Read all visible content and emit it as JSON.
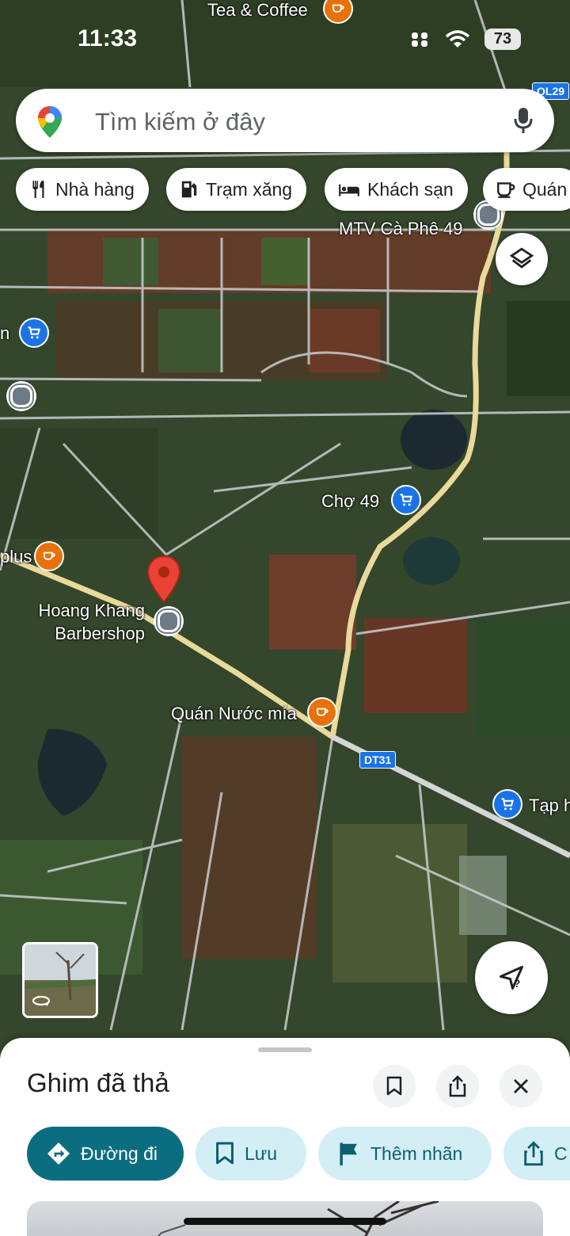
{
  "status_bar": {
    "time": "11:33",
    "battery": "73"
  },
  "search": {
    "placeholder": "Tìm kiếm ở đây"
  },
  "chips": [
    {
      "label": "Nhà hàng",
      "icon": "fork-knife-icon"
    },
    {
      "label": "Trạm xăng",
      "icon": "gas-pump-icon"
    },
    {
      "label": "Khách sạn",
      "icon": "bed-icon"
    },
    {
      "label": "Quán",
      "icon": "coffee-cup-icon"
    }
  ],
  "map": {
    "labels": {
      "tea_coffee": "Tea & Coffee",
      "cafe_49": "MTV Cà Phê 49",
      "market_49": "Chợ 49",
      "plus": "plus",
      "barbershop_line1": "Hoang Khang",
      "barbershop_line2": "Barbershop",
      "nuoc_mia": "Quán Nước mía",
      "tap_hoa": "Tạp h",
      "left_n": "n",
      "road_dt31": "DT31",
      "road_ql29": "QL29"
    }
  },
  "sheet": {
    "title": "Ghim đã thả",
    "actions": [
      {
        "label": "Đường đi",
        "icon": "directions-icon"
      },
      {
        "label": "Lưu",
        "icon": "bookmark-icon"
      },
      {
        "label": "Thêm nhãn",
        "icon": "flag-icon"
      },
      {
        "label": "C",
        "icon": "share-icon"
      }
    ]
  },
  "colors": {
    "primary_button": "#0b6e80",
    "secondary_button": "#d3eef5",
    "pin": "#ea4335",
    "shop_poi": "#1a73e8",
    "cafe_poi": "#e8710a"
  }
}
